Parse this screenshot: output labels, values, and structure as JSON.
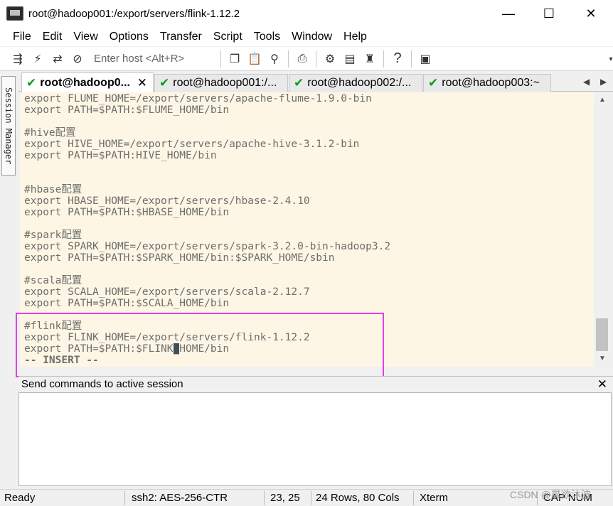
{
  "window": {
    "title": "root@hadoop001:/export/servers/flink-1.12.2",
    "minimize": "—",
    "maximize": "☐",
    "close": "✕"
  },
  "menu": [
    "File",
    "Edit",
    "View",
    "Options",
    "Transfer",
    "Script",
    "Tools",
    "Window",
    "Help"
  ],
  "toolbar": {
    "host_placeholder": "Enter host <Alt+R>",
    "icons": [
      "connect-icon",
      "lightning-icon",
      "reconnect-icon",
      "link-icon",
      "copy-icon",
      "paste-icon",
      "find-icon",
      "print-icon",
      "settings-icon",
      "keymap-icon",
      "key-icon",
      "help-icon",
      "sftp-icon"
    ]
  },
  "session_manager": {
    "label": "Session Manager"
  },
  "tabs": [
    {
      "label": "root@hadoop0...",
      "active": true
    },
    {
      "label": "root@hadoop001:/...",
      "active": false
    },
    {
      "label": "root@hadoop002:/...",
      "active": false
    },
    {
      "label": "root@hadoop003:~",
      "active": false
    }
  ],
  "terminal": {
    "lines": [
      "export FLUME_HOME=/export/servers/apache-flume-1.9.0-bin",
      "export PATH=$PATH:$FLUME_HOME/bin",
      "",
      "#hive配置",
      "export HIVE_HOME=/export/servers/apache-hive-3.1.2-bin",
      "export PATH=$PATH:HIVE_HOME/bin",
      "",
      "",
      "#hbase配置",
      "export HBASE_HOME=/export/servers/hbase-2.4.10",
      "export PATH=$PATH:$HBASE_HOME/bin",
      "",
      "#spark配置",
      "export SPARK_HOME=/export/servers/spark-3.2.0-bin-hadoop3.2",
      "export PATH=$PATH:$SPARK_HOME/bin:$SPARK_HOME/sbin",
      "",
      "#scala配置",
      "export SCALA_HOME=/export/servers/scala-2.12.7",
      "export PATH=$PATH:$SCALA_HOME/bin",
      "",
      "#flink配置",
      "export FLINK_HOME=/export/servers/flink-1.12.2"
    ],
    "cursor_line_before": "export PATH=$PATH:$FLINK",
    "cursor_char": "_",
    "cursor_line_after": "HOME/bin",
    "mode_line": "-- INSERT --"
  },
  "command_window": {
    "title": "Send commands to active session",
    "close": "✕"
  },
  "status": {
    "ready": "Ready",
    "cipher": "ssh2: AES-256-CTR",
    "position": "23,  25",
    "size": "24 Rows, 80 Cols",
    "terminal_type": "Xterm",
    "keys": "CAP NUM"
  },
  "watermark": "CSDN @晨欲沐波"
}
